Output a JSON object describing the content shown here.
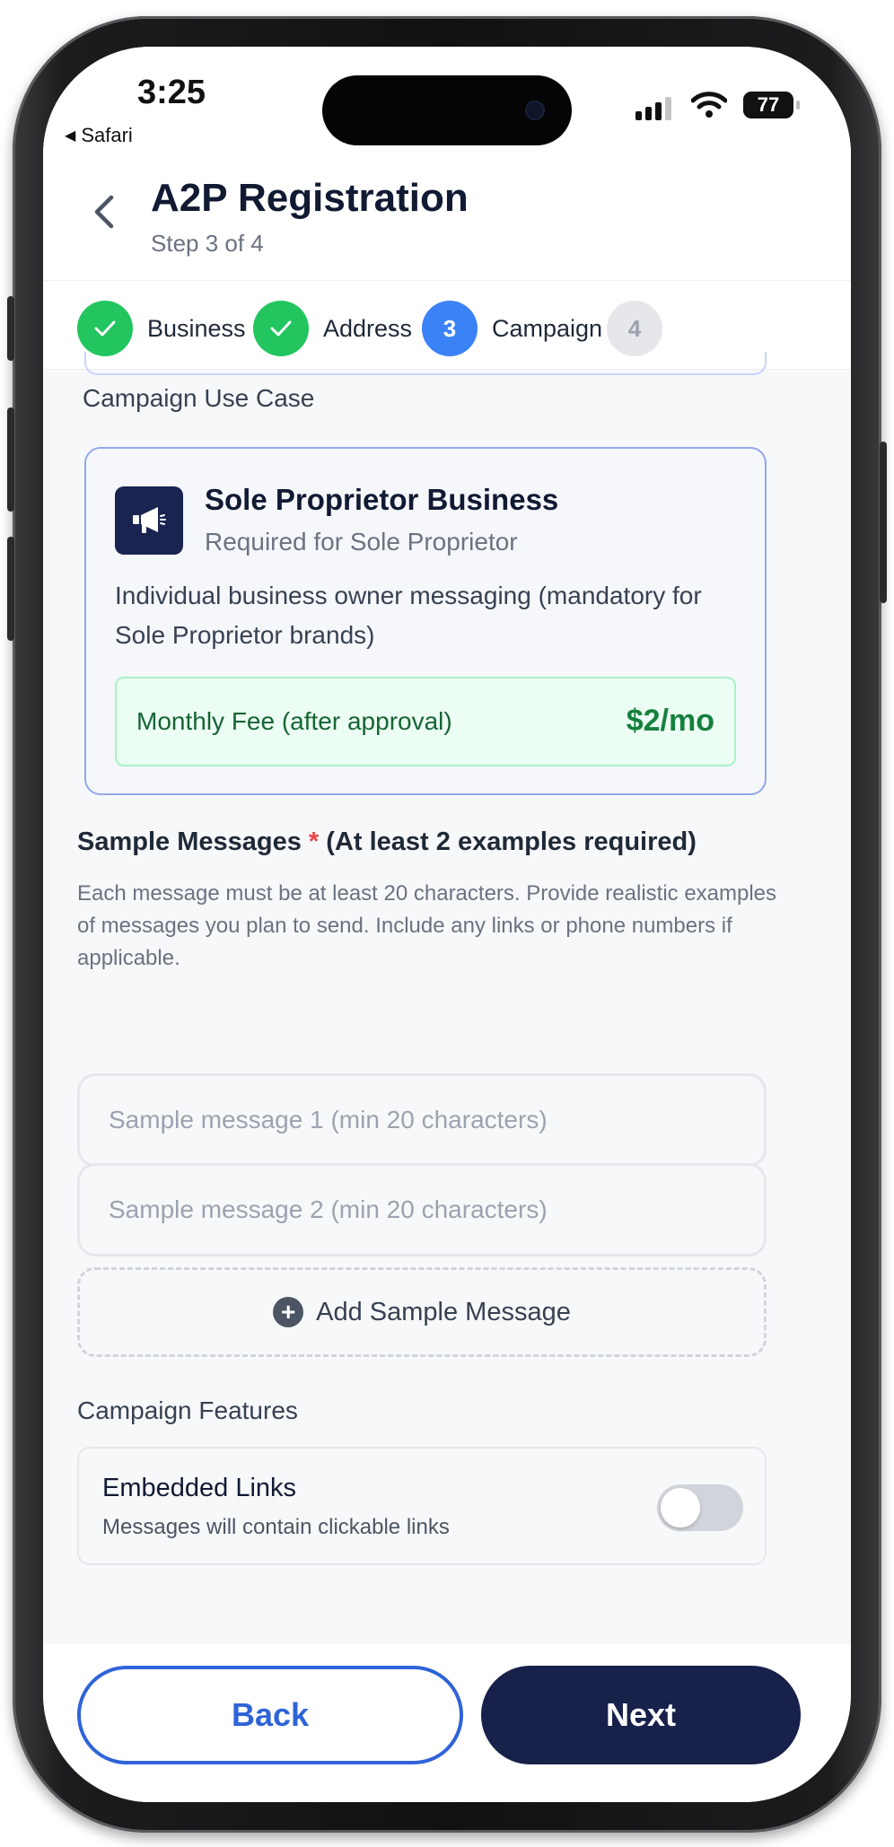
{
  "status_bar": {
    "time": "3:25",
    "back_app": "Safari",
    "battery": "77"
  },
  "header": {
    "title": "A2P Registration",
    "subtitle": "Step 3 of 4"
  },
  "stepper": {
    "steps": [
      {
        "number": "1",
        "label": "Business",
        "state": "done"
      },
      {
        "number": "2",
        "label": "Address",
        "state": "done"
      },
      {
        "number": "3",
        "label": "Campaign",
        "state": "active"
      },
      {
        "number": "4",
        "label": "",
        "state": "todo"
      }
    ]
  },
  "use_case": {
    "section_label": "Campaign Use Case",
    "icon": "megaphone-icon",
    "title": "Sole Proprietor Business",
    "subtitle": "Required for Sole Proprietor",
    "description": "Individual business owner messaging (mandatory for Sole Proprietor brands)",
    "fee_label": "Monthly Fee (after approval)",
    "fee_value": "$2/mo"
  },
  "sample_messages": {
    "title": "Sample Messages",
    "required_mark": "*",
    "title_suffix": "(At least 2 examples required)",
    "help": "Each message must be at least 20 characters. Provide realistic examples of messages you plan to send. Include any links or phone numbers if applicable.",
    "inputs": [
      {
        "placeholder": "Sample message 1 (min 20 characters)",
        "value": ""
      },
      {
        "placeholder": "Sample message 2 (min 20 characters)",
        "value": ""
      }
    ],
    "add_label": "Add Sample Message"
  },
  "features": {
    "title": "Campaign Features",
    "items": [
      {
        "name": "Embedded Links",
        "description": "Messages will contain clickable links",
        "enabled": false
      }
    ]
  },
  "footer": {
    "back_label": "Back",
    "next_label": "Next"
  },
  "colors": {
    "primary": "#17214a",
    "accent_blue": "#2f63d8",
    "success": "#22c55e",
    "fee_green": "#15803d"
  }
}
